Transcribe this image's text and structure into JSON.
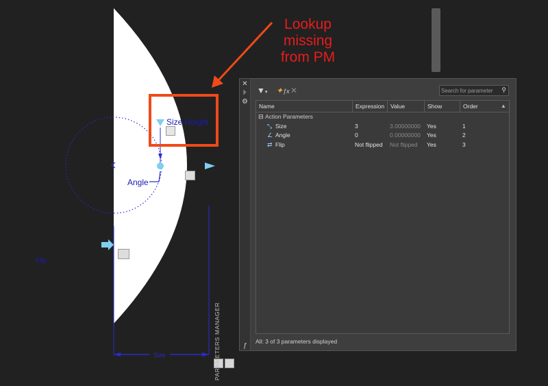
{
  "annotation": {
    "text_line1": "Lookup",
    "text_line2": "missing",
    "text_line3": "from PM",
    "color": "#e81c1c"
  },
  "drawing": {
    "size_label": "Size Height",
    "angle_label": "Angle",
    "flip_label": "Flip",
    "bottom_dim_label": "Size",
    "param_color": "#1a1ab8",
    "grip_color": "#7ecff0"
  },
  "palette": {
    "title": "PARAMETERS MANAGER",
    "search_placeholder": "Search for parameter",
    "columns": [
      "Name",
      "Expression",
      "Value",
      "Show",
      "Order"
    ],
    "group": {
      "label": "Action Parameters",
      "expanded": true
    },
    "rows": [
      {
        "name": "Size",
        "expression": "3",
        "value": "3.00000000",
        "show": "Yes",
        "order": "1",
        "icon": "linear-param-icon"
      },
      {
        "name": "Angle",
        "expression": "0",
        "value": "0.00000000",
        "show": "Yes",
        "order": "2",
        "icon": "rotation-param-icon"
      },
      {
        "name": "Flip",
        "expression": "Not flipped",
        "value": "Not flipped",
        "show": "Yes",
        "order": "3",
        "icon": "flip-param-icon"
      }
    ],
    "status": "All: 3 of 3 parameters displayed"
  }
}
